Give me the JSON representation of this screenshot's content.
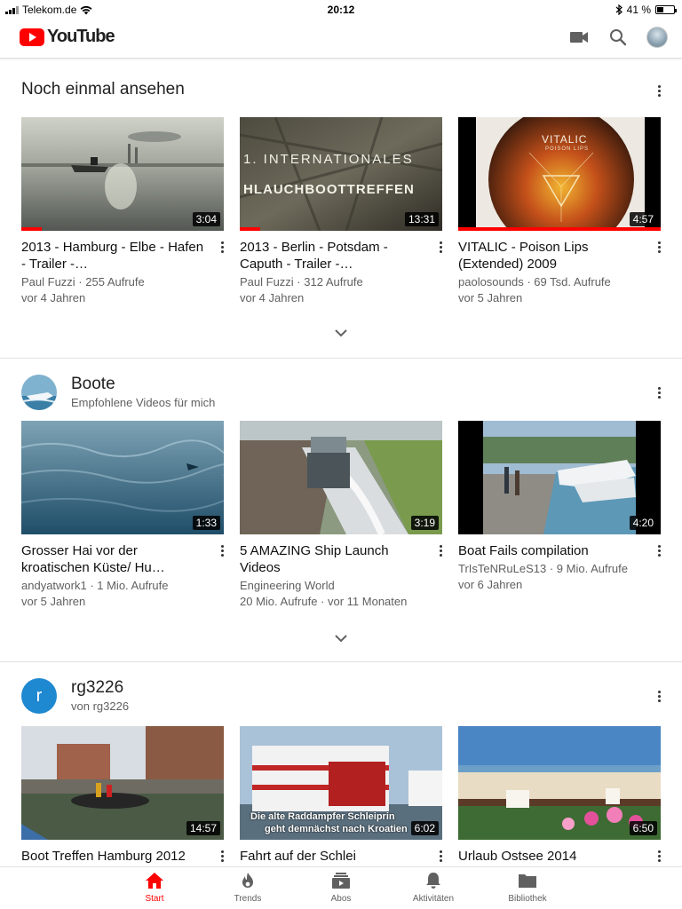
{
  "status_bar": {
    "carrier": "Telekom.de",
    "time": "20:12",
    "battery": "41 %",
    "battery_level": 0.41
  },
  "app": {
    "logo_text": "YouTube",
    "accent_color": "#ff0000"
  },
  "header_icons": [
    "video-camera-icon",
    "search-icon",
    "account-avatar"
  ],
  "shelves": [
    {
      "title": "Noch einmal ansehen",
      "videos": [
        {
          "title": "2013 - Hamburg - Elbe - Hafen - Trailer -…",
          "channel_views": "Paul Fuzzi · 255 Aufrufe",
          "age": "vor 4 Jahren",
          "duration": "3:04",
          "watched": 0.1
        },
        {
          "title": "2013 - Berlin - Potsdam - Caputh - Trailer -…",
          "channel_views": "Paul Fuzzi · 312 Aufrufe",
          "age": "vor 4 Jahren",
          "duration": "13:31",
          "watched": 0.1
        },
        {
          "title": "VITALIC - Poison Lips (Extended) 2009",
          "channel_views": "paolosounds · 69 Tsd. Aufrufe",
          "age": "vor 5 Jahren",
          "duration": "4:57",
          "watched": 1.0,
          "thumb_text": "VITALIC",
          "thumb_subtext": "POISON LIPS"
        }
      ]
    },
    {
      "title": "Boote",
      "subtitle": "Empfohlene Videos für mich",
      "videos": [
        {
          "title": "Grosser Hai vor der kroatischen Küste/ Hu…",
          "channel_views": "andyatwork1 · 1 Mio. Aufrufe",
          "age": "vor 5 Jahren",
          "duration": "1:33"
        },
        {
          "title": "5 AMAZING Ship Launch Videos",
          "channel_views": "Engineering World",
          "age": "20 Mio. Aufrufe · vor 11 Monaten",
          "duration": "3:19"
        },
        {
          "title": "Boat Fails compilation",
          "channel_views": "TrIsTeNRuLeS13 · 9 Mio. Aufrufe",
          "age": "vor 6 Jahren",
          "duration": "4:20"
        }
      ]
    },
    {
      "title": "rg3226",
      "subtitle": "von rg3226",
      "avatar_letter": "r",
      "avatar_color": "#1e88d0",
      "videos": [
        {
          "title": "Boot Treffen Hamburg 2012",
          "duration": "14:57"
        },
        {
          "title": "Fahrt auf der Schlei",
          "duration": "6:02",
          "thumb_text": "Die alte Raddampfer Schleiprin",
          "thumb_subtext": "geht demnächst nach Kroatien"
        },
        {
          "title": "Urlaub Ostsee 2014",
          "duration": "6:50"
        }
      ]
    }
  ],
  "bottom_nav": [
    {
      "label": "Start",
      "icon": "home-icon",
      "active": true
    },
    {
      "label": "Trends",
      "icon": "flame-icon"
    },
    {
      "label": "Abos",
      "icon": "subscriptions-icon"
    },
    {
      "label": "Aktivitäten",
      "icon": "bell-icon"
    },
    {
      "label": "Bibliothek",
      "icon": "folder-icon"
    }
  ]
}
